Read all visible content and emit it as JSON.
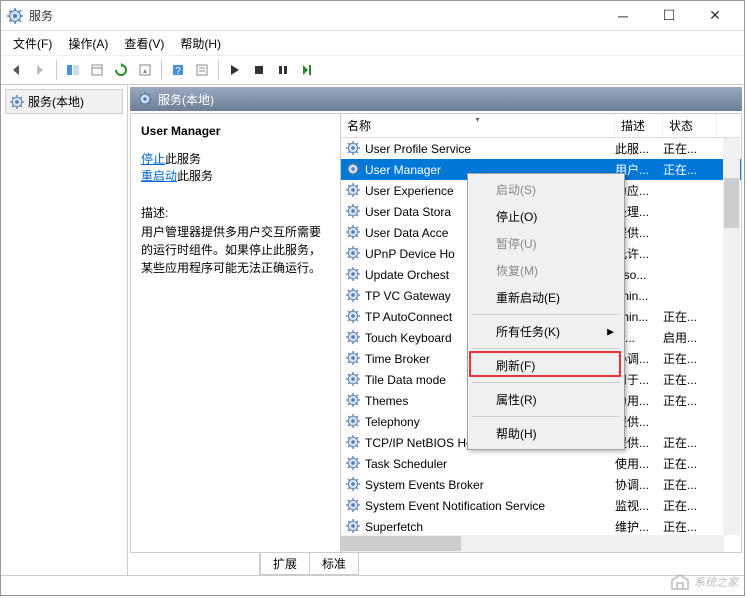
{
  "window": {
    "title": "服务"
  },
  "menus": {
    "file": "文件(F)",
    "action": "操作(A)",
    "view": "查看(V)",
    "help": "帮助(H)"
  },
  "tree": {
    "root": "服务(本地)"
  },
  "panel_header": "服务(本地)",
  "detail": {
    "title": "User Manager",
    "stop_link": "停止",
    "stop_suffix": "此服务",
    "restart_link": "重启动",
    "restart_suffix": "此服务",
    "desc_label": "描述:",
    "desc_text": "用户管理器提供多用户交互所需要的运行时组件。如果停止此服务，某些应用程序可能无法正确运行。"
  },
  "columns": {
    "name": "名称",
    "desc": "描述",
    "status": "状态"
  },
  "services": [
    {
      "name": "User Profile Service",
      "desc": "此服...",
      "status": "正在..."
    },
    {
      "name": "User Manager",
      "desc": "用户...",
      "status": "正在...",
      "selected": true
    },
    {
      "name": "User Experience",
      "desc": "为应...",
      "status": ""
    },
    {
      "name": "User Data Stora",
      "desc": "处理...",
      "status": ""
    },
    {
      "name": "User Data Acce",
      "desc": "提供...",
      "status": ""
    },
    {
      "name": "UPnP Device Ho",
      "desc": "允许...",
      "status": ""
    },
    {
      "name": "Update Orchest",
      "desc": "Uso...",
      "status": ""
    },
    {
      "name": "TP VC Gateway",
      "desc": "Thin...",
      "status": ""
    },
    {
      "name": "TP AutoConnect",
      "desc": "Thin...",
      "status": "正在..."
    },
    {
      "name": "Touch Keyboard",
      "desc": "er...",
      "status": "启用..."
    },
    {
      "name": "Time Broker",
      "desc": "协调...",
      "status": "正在..."
    },
    {
      "name": "Tile Data mode",
      "desc": "用于...",
      "status": "正在..."
    },
    {
      "name": "Themes",
      "desc": "为用...",
      "status": "正在..."
    },
    {
      "name": "Telephony",
      "desc": "提供...",
      "status": ""
    },
    {
      "name": "TCP/IP NetBIOS Helper",
      "desc": "提供...",
      "status": "正在..."
    },
    {
      "name": "Task Scheduler",
      "desc": "使用...",
      "status": "正在..."
    },
    {
      "name": "System Events Broker",
      "desc": "协调...",
      "status": "正在..."
    },
    {
      "name": "System Event Notification Service",
      "desc": "监视...",
      "status": "正在..."
    },
    {
      "name": "Superfetch",
      "desc": "维护...",
      "status": "正在..."
    }
  ],
  "context_menu": [
    {
      "label": "启动(S)",
      "disabled": true
    },
    {
      "label": "停止(O)"
    },
    {
      "label": "暂停(U)",
      "disabled": true
    },
    {
      "label": "恢复(M)",
      "disabled": true
    },
    {
      "label": "重新启动(E)"
    },
    {
      "sep": true
    },
    {
      "label": "所有任务(K)",
      "submenu": true
    },
    {
      "sep": true
    },
    {
      "label": "刷新(F)"
    },
    {
      "sep": true
    },
    {
      "label": "属性(R)",
      "highlight": true
    },
    {
      "sep": true
    },
    {
      "label": "帮助(H)"
    }
  ],
  "tabs": {
    "extended": "扩展",
    "standard": "标准"
  },
  "watermark": "系统之家"
}
